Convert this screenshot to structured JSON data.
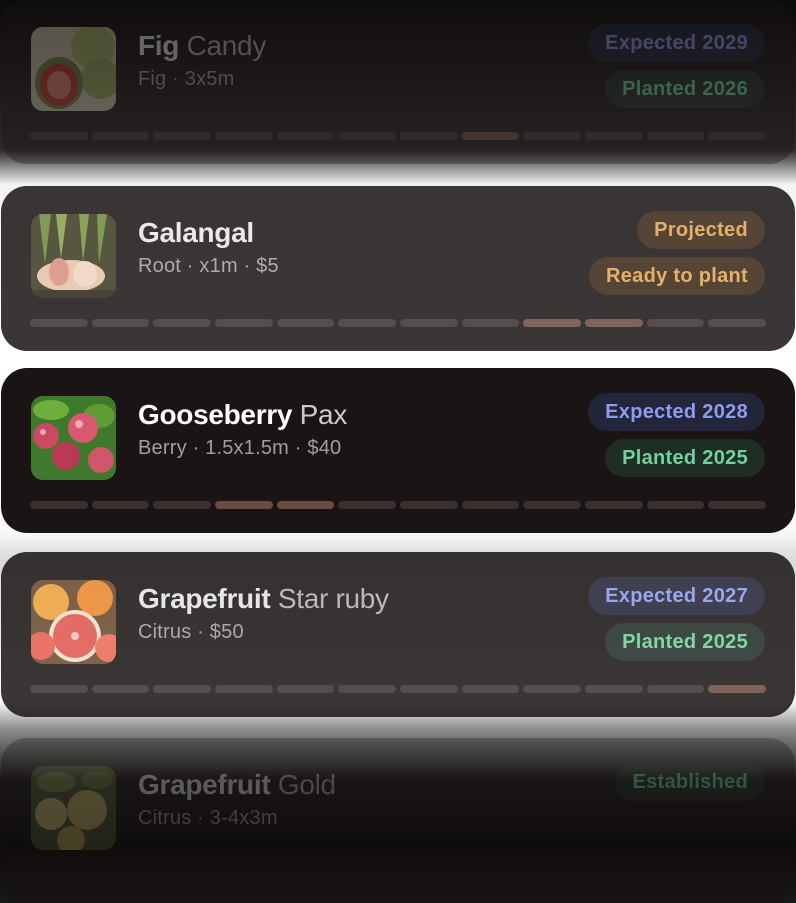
{
  "cards": [
    {
      "name": "Fig",
      "variety": "Candy",
      "subtitle": "Fig · 3x5m",
      "badges": [
        "Expected 2029",
        "Planted 2026"
      ],
      "image_icon": "fig-photo",
      "progress_active_segments": [
        8
      ]
    },
    {
      "name": "Galangal",
      "variety": "",
      "subtitle": "Root · x1m · $5",
      "badges": [
        "Projected",
        "Ready to plant"
      ],
      "image_icon": "galangal-photo",
      "progress_active_segments": [
        9,
        10
      ]
    },
    {
      "name": "Gooseberry",
      "variety": "Pax",
      "subtitle": "Berry · 1.5x1.5m · $40",
      "badges": [
        "Expected 2028",
        "Planted 2025"
      ],
      "image_icon": "gooseberry-photo",
      "progress_active_segments": [
        4,
        5
      ]
    },
    {
      "name": "Grapefruit",
      "variety": "Star ruby",
      "subtitle": "Citrus · $50",
      "badges": [
        "Expected 2027",
        "Planted 2025"
      ],
      "image_icon": "grapefruit-photo",
      "progress_active_segments": [
        12
      ]
    },
    {
      "name": "Grapefruit",
      "variety": "Gold",
      "subtitle": "Citrus · 3-4x3m",
      "badges": [
        "Established"
      ],
      "image_icon": "grapefruit-gold-photo",
      "progress_active_segments": []
    }
  ],
  "progress_segment_count": 12,
  "colors": {
    "card_bg": "#1a1414",
    "expected_badge_text": "#8f9cee",
    "planted_badge_text": "#6fd39b",
    "warning_badge_text": "#e0a552",
    "segment_inactive": "#3a3030",
    "segment_active": "#6b4a3f"
  }
}
